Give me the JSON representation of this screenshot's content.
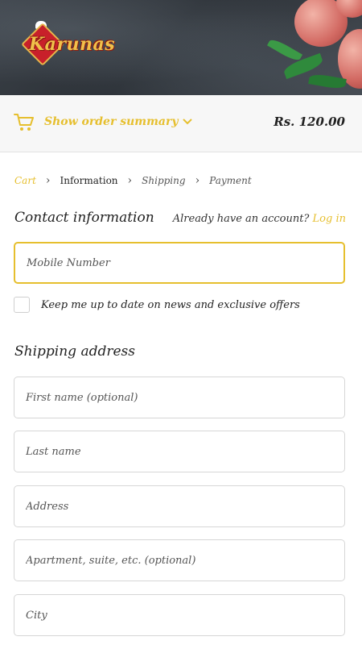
{
  "brand": {
    "name": "Karunas"
  },
  "order_summary": {
    "toggle_label": "Show order summary",
    "price": "Rs. 120.00",
    "icons": [
      "cart-icon",
      "chevron-down-icon"
    ]
  },
  "breadcrumb": {
    "items": [
      "Cart",
      "Information",
      "Shipping",
      "Payment"
    ]
  },
  "contact": {
    "title": "Contact information",
    "account_prompt": "Already have an account?",
    "login_label": "Log in",
    "mobile_placeholder": "Mobile Number",
    "newsletter_label": "Keep me up to date on news and exclusive offers"
  },
  "shipping": {
    "title": "Shipping address",
    "first_name_placeholder": "First name (optional)",
    "last_name_placeholder": "Last name",
    "address_placeholder": "Address",
    "apartment_placeholder": "Apartment, suite, etc. (optional)",
    "city_placeholder": "City"
  },
  "colors": {
    "accent": "#e6bf2e",
    "text": "#222222",
    "border": "#d6d6d6"
  }
}
